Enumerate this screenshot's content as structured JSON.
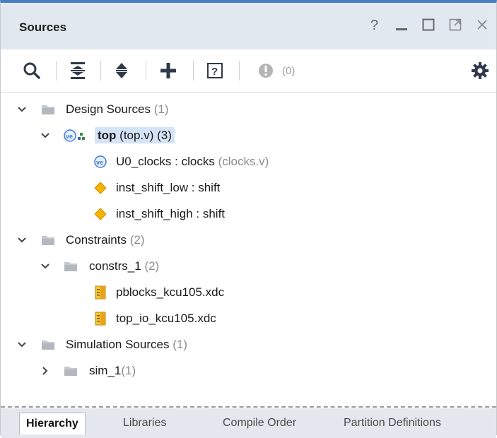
{
  "panel": {
    "title": "Sources",
    "window_controls": [
      "help-icon",
      "minimize-icon",
      "maximize-icon",
      "float-icon",
      "close-icon"
    ]
  },
  "toolbar": {
    "buttons": [
      "search-icon",
      "collapse-all-icon",
      "expand-all-icon",
      "add-sources-icon",
      "properties-icon",
      "warning-icon"
    ],
    "warning_count": "(0)"
  },
  "tree": {
    "design_sources": {
      "label": "Design Sources",
      "count": "(1)"
    },
    "top": {
      "label": "top",
      "file": "(top.v)",
      "count": "(3)"
    },
    "u0_clocks": {
      "label": "U0_clocks : clocks",
      "file": "(clocks.v)"
    },
    "inst_shift_low": {
      "label": "inst_shift_low : shift"
    },
    "inst_shift_high": {
      "label": "inst_shift_high : shift"
    },
    "constraints": {
      "label": "Constraints",
      "count": "(2)"
    },
    "constrs_1": {
      "label": "constrs_1",
      "count": "(2)"
    },
    "pblocks": {
      "label": "pblocks_kcu105.xdc"
    },
    "top_io": {
      "label": "top_io_kcu105.xdc"
    },
    "simulation_sources": {
      "label": "Simulation Sources",
      "count": "(1)"
    },
    "sim_1": {
      "label": "sim_1",
      "count": "(1)"
    }
  },
  "tabs": {
    "hierarchy": "Hierarchy",
    "libraries": "Libraries",
    "compile_order": "Compile Order",
    "partition_definitions": "Partition Definitions"
  },
  "colors": {
    "accent": "#4a7ebf",
    "selection": "#d4e3f6",
    "titlebar": "#e2e8ef",
    "diamond": "#f5b301",
    "verilog_icon": "#3d7ad6"
  }
}
